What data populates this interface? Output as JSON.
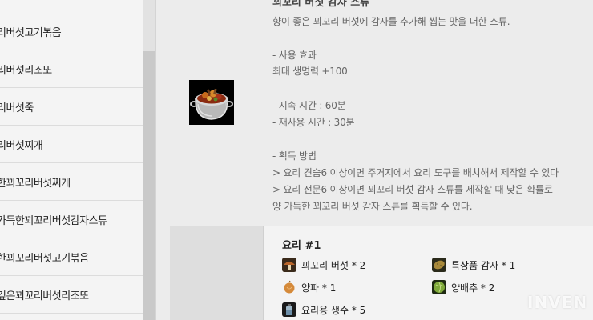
{
  "list": {
    "items": [
      "리버섯고기볶음",
      "리버섯리조또",
      "리버섯죽",
      "리버섯찌개",
      "한꾀꼬리버섯찌개",
      "가득한꾀꼬리버섯감자스튜",
      "한꾀꼬리버섯고기볶음",
      "깊은꾀꼬리버섯리조또"
    ]
  },
  "item": {
    "title": "꾀꼬리 버섯 감자 스튜",
    "icon": "stew-pot-icon",
    "desc_lines": [
      "향이 좋은 꾀꼬리 버섯에 감자를 추가해 씹는 맛을 더한 스튜.",
      "",
      "- 사용 효과",
      "최대 생명력 +100",
      "",
      "- 지속 시간 : 60분",
      "- 재사용 시간 : 30분",
      "",
      "- 획득 방법",
      "> 요리 견습6 이상이면 주거지에서 요리 도구를 배치해서 제작할 수 있다",
      "> 요리 전문6 이상이면 꾀꼬리 버섯 감자 스튜를 제작할 때 낮은 확률로",
      "양 가득한 꾀꼬리 버섯 감자 스튜를 획득할 수 있다."
    ]
  },
  "recipe": {
    "title": "요리 #1",
    "ingredients": [
      {
        "label": "꾀꼬리 버섯 * 2",
        "icon": "mushroom-icon"
      },
      {
        "label": "특상품 감자 * 1",
        "icon": "potato-icon"
      },
      {
        "label": "양파 * 1",
        "icon": "onion-icon"
      },
      {
        "label": "양배추 * 2",
        "icon": "cabbage-icon"
      },
      {
        "label": "요리용 생수 * 5",
        "icon": "water-bottle-icon"
      }
    ]
  },
  "watermark": "INVEN",
  "colors": {
    "panel_bg": "#f4f4f4",
    "content_bg": "#ececec",
    "scroll_thumb": "#c9c9c9"
  }
}
